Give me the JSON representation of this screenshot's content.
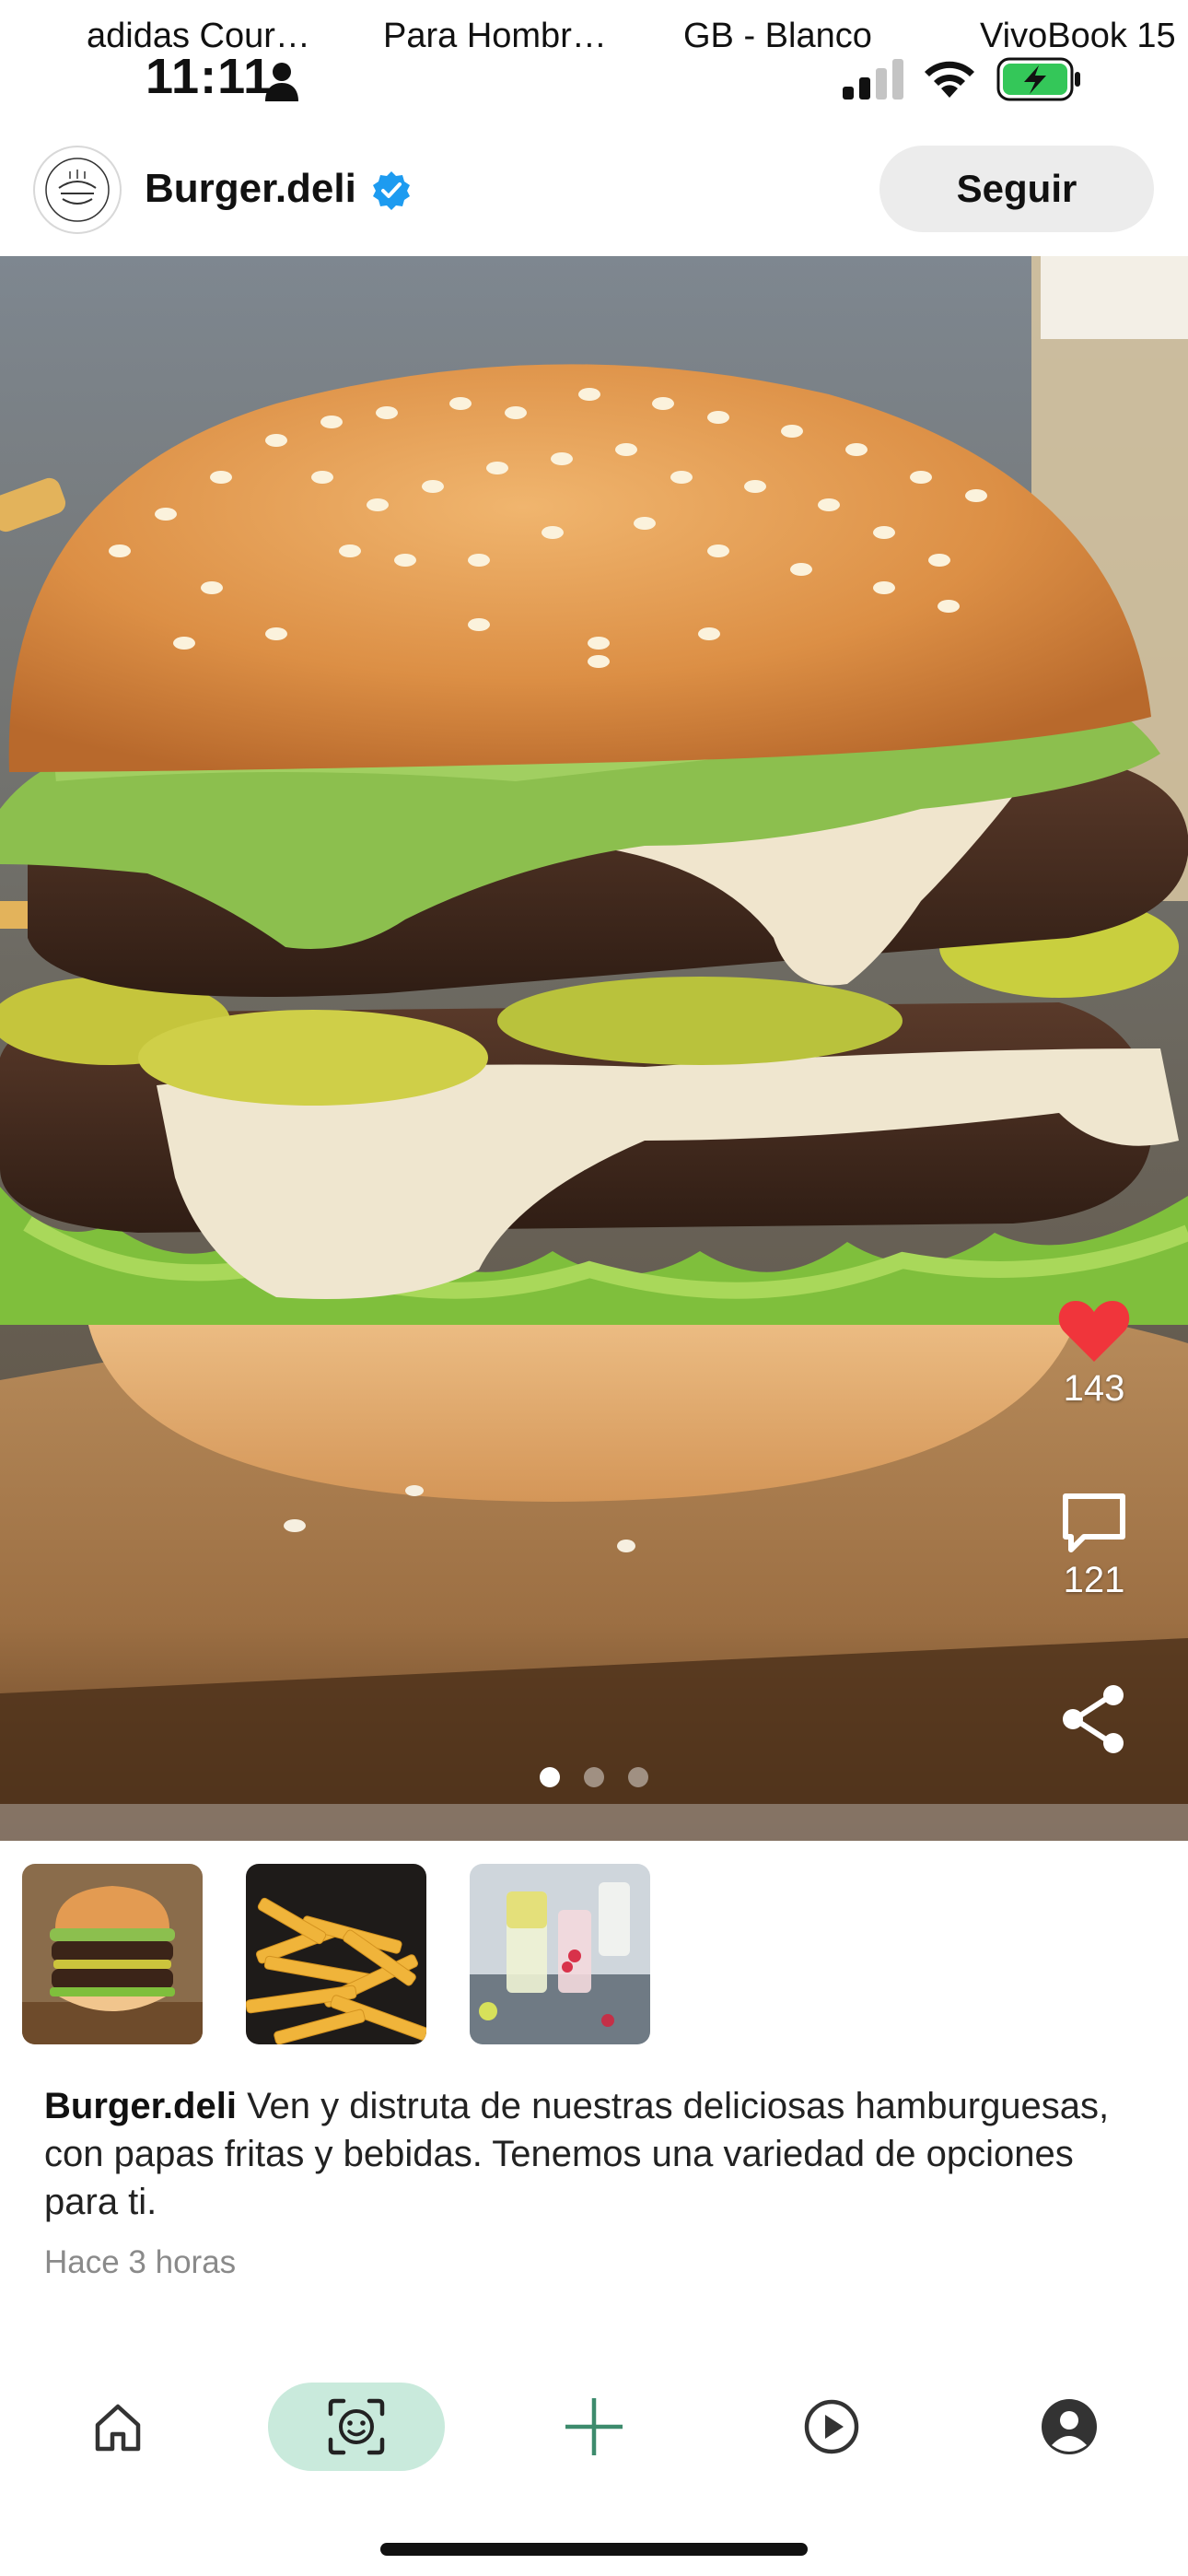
{
  "status_bar": {
    "marquee": [
      "adidas Cour…",
      "Para Hombr…",
      "GB - Blanco",
      "VivoBook 15"
    ],
    "time": "11:11",
    "icons": [
      "person-icon",
      "signal-icon",
      "wifi-icon",
      "battery-charging-icon"
    ],
    "battery_color": "#34c759"
  },
  "header": {
    "account_name": "Burger.deli",
    "verified_color": "#1d9bf0",
    "follow_label": "Seguir"
  },
  "post": {
    "image_description_icon": "burger-photo",
    "actions": {
      "likes": "143",
      "comments": "121",
      "like_color": "#f0353b"
    },
    "carousel_active_index": 0,
    "carousel_count": 3,
    "thumbnails": [
      "burger-thumbnail",
      "fries-thumbnail",
      "drinks-thumbnail"
    ],
    "caption_author": "Burger.deli",
    "caption_text": " Ven y distruta de nuestras deliciosas hamburguesas, con papas fritas y bebidas. Tenemos una variedad de opciones para ti.",
    "time_ago": "Hace 3 horas"
  },
  "bottom_nav": {
    "items": [
      "home-icon",
      "face-scan-icon",
      "add-icon",
      "play-icon",
      "profile-icon"
    ],
    "active": "face-scan-icon",
    "accent": "#c9eadc",
    "add_color": "#3d8b6d"
  }
}
